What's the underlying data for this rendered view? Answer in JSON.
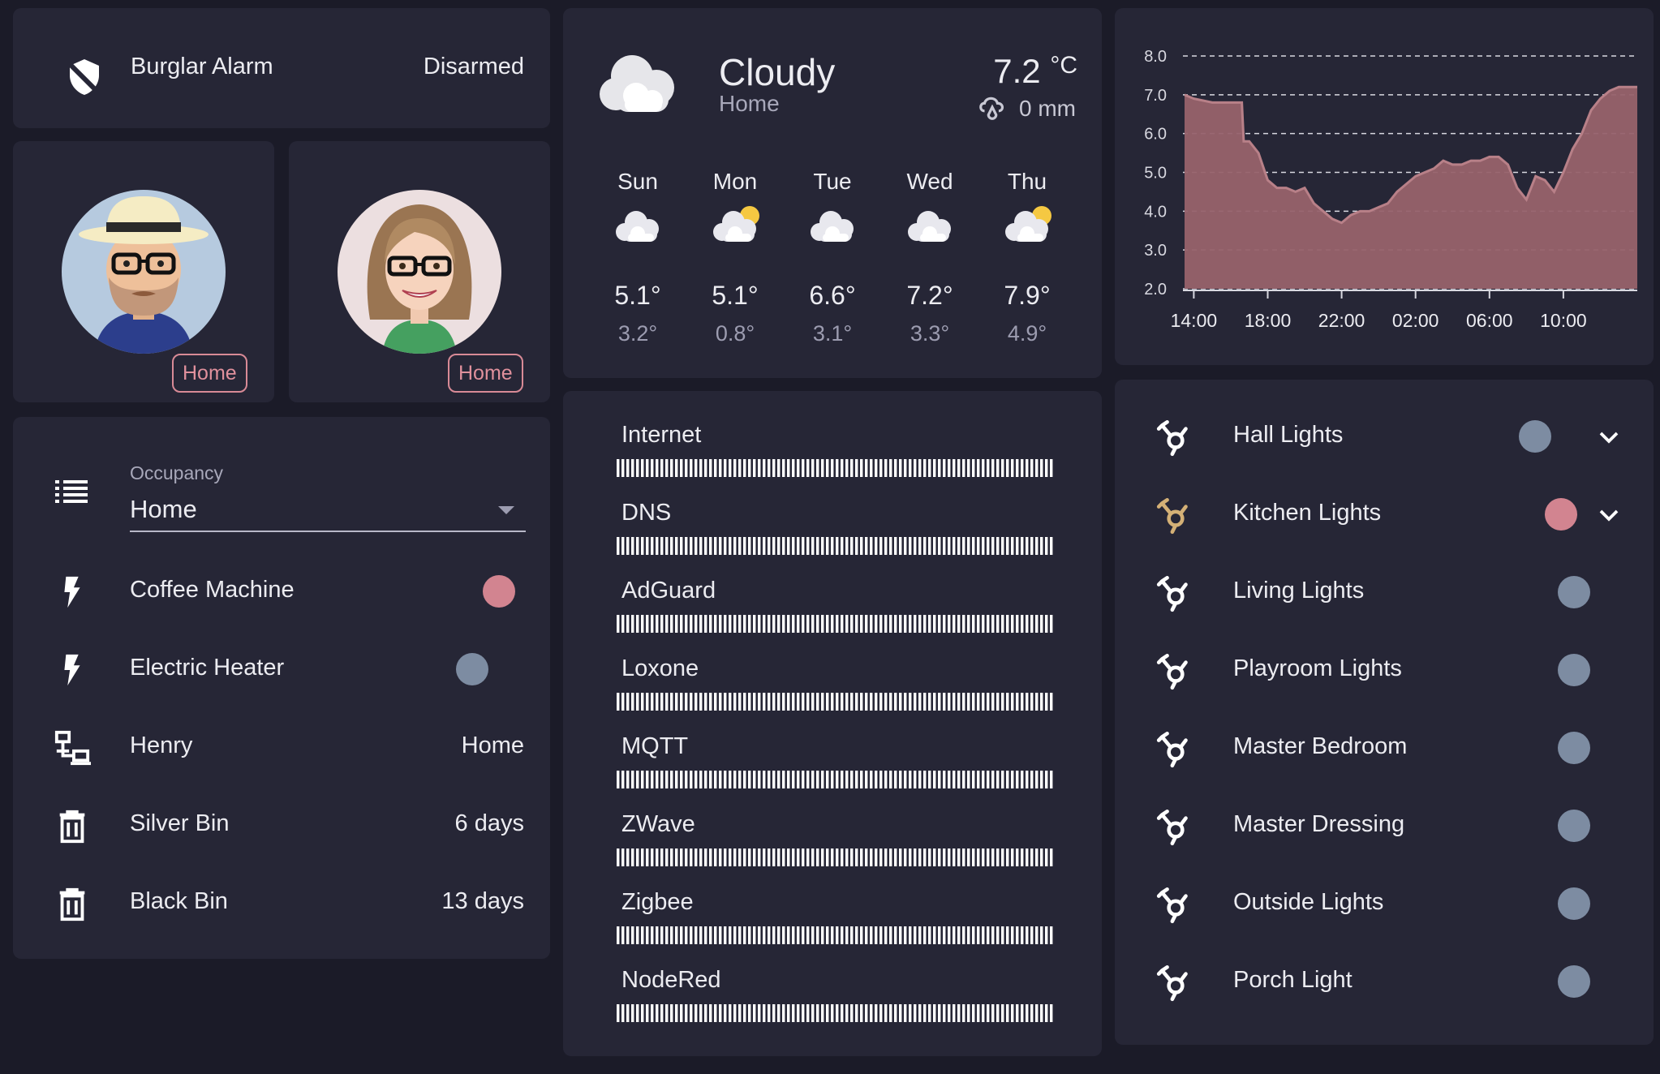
{
  "alarm": {
    "label": "Burglar Alarm",
    "state": "Disarmed",
    "icon": "shield-off-icon"
  },
  "persons": [
    {
      "status": "Home",
      "icon": "avatar-man-hat"
    },
    {
      "status": "Home",
      "icon": "avatar-woman-glasses"
    }
  ],
  "entities": {
    "occupancy": {
      "label": "Occupancy",
      "value": "Home",
      "icon": "list-icon"
    },
    "rows": [
      {
        "label": "Coffee Machine",
        "type": "toggle",
        "on": true,
        "icon": "flash-icon"
      },
      {
        "label": "Electric Heater",
        "type": "toggle",
        "on": false,
        "icon": "flash-icon"
      },
      {
        "label": "Henry",
        "value": "Home",
        "icon": "lan-icon"
      },
      {
        "label": "Silver Bin",
        "value": "6 days",
        "icon": "trash-can-icon"
      },
      {
        "label": "Black Bin",
        "value": "13 days",
        "icon": "trash-can-icon"
      }
    ]
  },
  "weather": {
    "condition": "Cloudy",
    "location": "Home",
    "temperature": "7.2",
    "unit": "°C",
    "precipitation": "0 mm",
    "forecast": [
      {
        "day": "Sun",
        "high": "5.1°",
        "low": "3.2°",
        "icon": "cloudy-icon"
      },
      {
        "day": "Mon",
        "high": "5.1°",
        "low": "0.8°",
        "icon": "partly-cloudy-icon"
      },
      {
        "day": "Tue",
        "high": "6.6°",
        "low": "3.1°",
        "icon": "cloudy-icon"
      },
      {
        "day": "Wed",
        "high": "7.2°",
        "low": "3.3°",
        "icon": "cloudy-icon"
      },
      {
        "day": "Thu",
        "high": "7.9°",
        "low": "4.9°",
        "icon": "partly-cloudy-icon"
      }
    ]
  },
  "network": {
    "services": [
      "Internet",
      "DNS",
      "AdGuard",
      "Loxone",
      "MQTT",
      "ZWave",
      "Zigbee",
      "NodeRed"
    ],
    "bar_color": "#ffffff"
  },
  "chart_data": {
    "type": "area",
    "y_ticks": [
      "8.0",
      "7.0",
      "6.0",
      "5.0",
      "4.0",
      "3.0",
      "2.0"
    ],
    "x_ticks": [
      "14:00",
      "18:00",
      "22:00",
      "02:00",
      "06:00",
      "10:00"
    ],
    "ylim": [
      2,
      8
    ],
    "grid": true,
    "fill_color": "#97626b",
    "line_color": "#b88088",
    "x": [
      13.5,
      14,
      15,
      16,
      16.6,
      16.7,
      17,
      17.5,
      18,
      18.5,
      19,
      19.5,
      20,
      20.5,
      21,
      21.5,
      22,
      22.5,
      23,
      23.5,
      24,
      24.5,
      25,
      25.5,
      26,
      26.5,
      27,
      27.5,
      28,
      28.5,
      29,
      29.5,
      30,
      30.5,
      31,
      31.5,
      32,
      32.5,
      33,
      33.5,
      34,
      34.5,
      35,
      35.5,
      36,
      36.5,
      37,
      37.5,
      38
    ],
    "values": [
      7.0,
      6.9,
      6.8,
      6.8,
      6.8,
      5.8,
      5.8,
      5.5,
      4.8,
      4.6,
      4.6,
      4.5,
      4.6,
      4.2,
      4.0,
      3.8,
      3.7,
      3.9,
      4.0,
      4.0,
      4.1,
      4.2,
      4.5,
      4.7,
      4.9,
      5.0,
      5.1,
      5.3,
      5.2,
      5.2,
      5.3,
      5.3,
      5.4,
      5.4,
      5.2,
      4.6,
      4.3,
      4.9,
      4.8,
      4.5,
      5.0,
      5.6,
      6.0,
      6.6,
      6.9,
      7.1,
      7.2,
      7.2,
      7.2
    ]
  },
  "lights": {
    "rows": [
      {
        "label": "Hall Lights",
        "on": false,
        "expandable": true,
        "icon": "hubitat-icon"
      },
      {
        "label": "Kitchen Lights",
        "on": true,
        "expandable": true,
        "icon": "hubitat-icon"
      },
      {
        "label": "Living Lights",
        "on": false,
        "expandable": false,
        "icon": "hubitat-icon"
      },
      {
        "label": "Playroom Lights",
        "on": false,
        "expandable": false,
        "icon": "hubitat-icon"
      },
      {
        "label": "Master Bedroom",
        "on": false,
        "expandable": false,
        "icon": "hubitat-icon"
      },
      {
        "label": "Master Dressing",
        "on": false,
        "expandable": false,
        "icon": "hubitat-icon"
      },
      {
        "label": "Outside Lights",
        "on": false,
        "expandable": false,
        "icon": "hubitat-icon"
      },
      {
        "label": "Porch Light",
        "on": false,
        "expandable": false,
        "icon": "hubitat-icon"
      }
    ]
  },
  "colors": {
    "background": "#1b1b28",
    "card": "#262636",
    "toggle_on": "#d28490",
    "toggle_off": "#7d8ca2",
    "accent_icon": "#d4b076",
    "badge": "#d88a96"
  }
}
